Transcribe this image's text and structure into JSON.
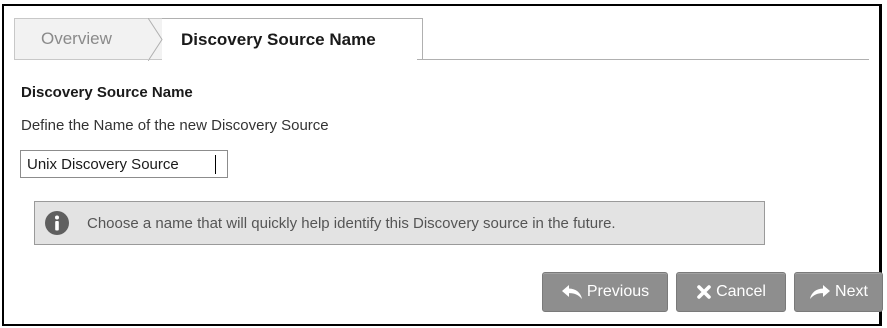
{
  "tabs": {
    "overview": "Overview",
    "active": "Discovery Source Name"
  },
  "section": {
    "title": "Discovery Source Name",
    "description": "Define the Name of the new Discovery Source"
  },
  "name_input": {
    "value": "Unix Discovery Source"
  },
  "info": {
    "icon": "info-icon",
    "text": "Choose a name that will quickly help identify this Discovery source in the future."
  },
  "buttons": {
    "previous": "Previous",
    "cancel": "Cancel",
    "next": "Next"
  },
  "colors": {
    "button_bg": "#8e8e8e",
    "info_bg": "#e3e3e3",
    "info_icon": "#5f5f5f"
  }
}
